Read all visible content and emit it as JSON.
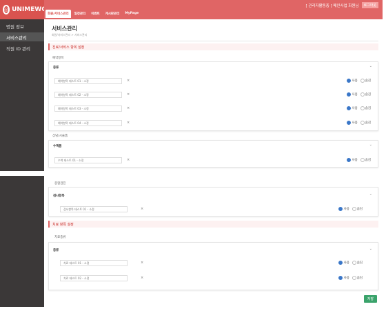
{
  "brand": {
    "name": "UNIMEWO"
  },
  "header": {
    "notice": "[ 관리자활동중 ] 메인사업 화원님",
    "logout": "로그아웃",
    "tabs": [
      "회원/서비스관리",
      "일정관리",
      "이벤트",
      "게시판관리",
      "MyPage"
    ]
  },
  "sidebar": {
    "items": [
      "병원 정보",
      "서비스관리",
      "직원 ID 관리"
    ]
  },
  "page": {
    "title": "서비스관리",
    "breadcrumb": "회원/서비스관리 > 서비스관리",
    "save_label": "저장"
  },
  "radio": {
    "use": "사용",
    "hide": "숨김"
  },
  "sections": {
    "checkup_title": "진료/서비스 항목 설정",
    "group1_label": "예약항목",
    "group1_box": "종류",
    "group1_rows": [
      "예약항목 테스트 01 - 소정",
      "예약항목 테스트 02 - 소정",
      "예약항목 테스트 03 - 소정",
      "예약항목 테스트 04 - 소정"
    ],
    "group2_label": "상담/시술폼",
    "group2_box": "수액폼",
    "group2_rows": [
      "수액 테스트 01 - 소정"
    ],
    "group3_label": "종합검진",
    "group3_box": "검사항목",
    "group3_rows": [
      "검사항목 테스트 01 - 소정"
    ],
    "treat_title": "치료 항목 설정",
    "group4_label": "치료종류",
    "group4_box": "종류",
    "group4_rows": [
      "치료 테스트 01 - 소정",
      "치료 테스트 02 - 소정"
    ]
  }
}
